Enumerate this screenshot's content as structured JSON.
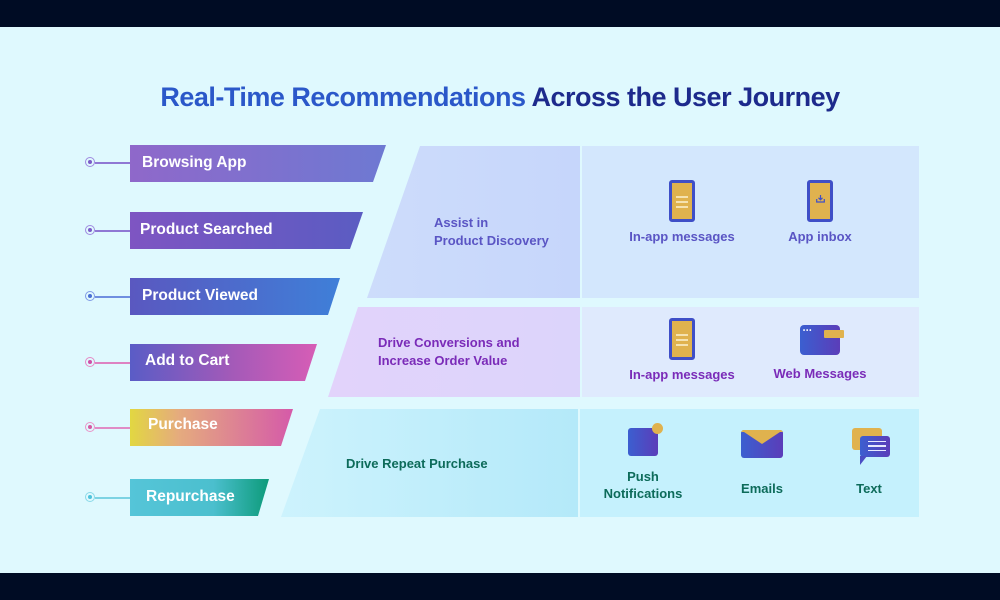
{
  "title": {
    "highlight": "Real-Time Recommendations",
    "rest": "Across the User Journey"
  },
  "colors": {
    "background": "#dff9fe",
    "frame": "#000c24",
    "title_highlight": "#2b58c9",
    "title_rest": "#1d2a8c",
    "icon_yellow": "#e0b24e",
    "icon_blue": "#3f4fc7"
  },
  "stages": [
    {
      "label": "Browsing App",
      "dot_color": "#7b5cc8"
    },
    {
      "label": "Product Searched",
      "dot_color": "#7b5cc8"
    },
    {
      "label": "Product Viewed",
      "dot_color": "#4a6fd4"
    },
    {
      "label": "Add to Cart",
      "dot_color": "#d04fa8"
    },
    {
      "label": "Purchase",
      "dot_color": "#d65aa3"
    },
    {
      "label": "Repurchase",
      "dot_color": "#4ec3db"
    }
  ],
  "goals": [
    {
      "label_line1": "Assist in",
      "label_line2": "Product Discovery",
      "color": "#5a55c4",
      "channels": [
        {
          "icon": "phone-messages-icon",
          "label": "In-app messages"
        },
        {
          "icon": "phone-inbox-icon",
          "label": "App inbox"
        }
      ]
    },
    {
      "label_line1": "Drive Conversions and",
      "label_line2": "Increase Order Value",
      "color": "#7a2bb8",
      "channels": [
        {
          "icon": "phone-messages-icon",
          "label": "In-app messages"
        },
        {
          "icon": "browser-window-icon",
          "label": "Web Messages"
        }
      ]
    },
    {
      "label_line1": "Drive Repeat Purchase",
      "label_line2": "",
      "color": "#0d6b5a",
      "channels": [
        {
          "icon": "push-notification-icon",
          "label_line1": "Push",
          "label_line2": "Notifications"
        },
        {
          "icon": "envelope-icon",
          "label": "Emails"
        },
        {
          "icon": "chat-bubbles-icon",
          "label": "Text"
        }
      ]
    }
  ]
}
